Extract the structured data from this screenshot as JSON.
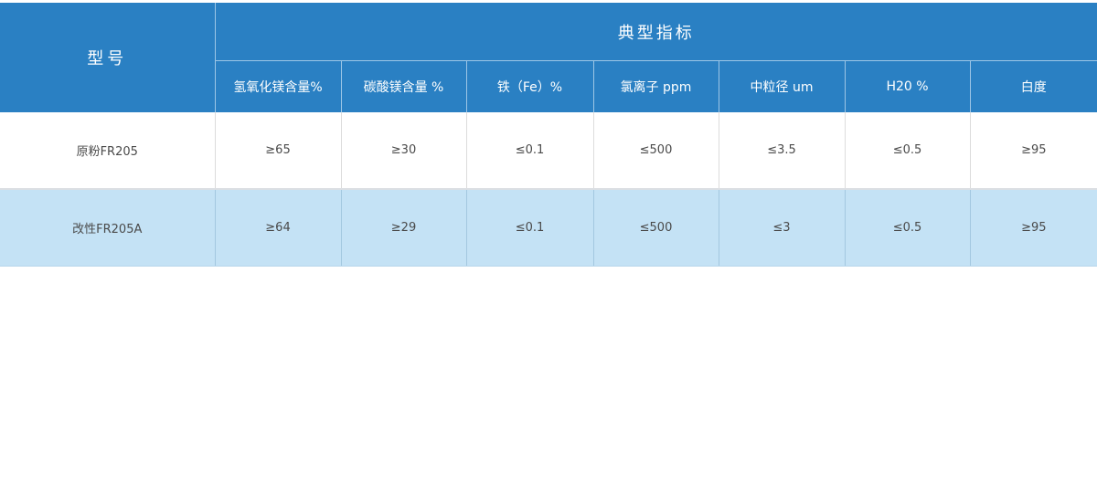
{
  "table": {
    "model_header": "型号",
    "group_header": "典型指标",
    "columns": [
      "氢氧化镁含量%",
      "碳酸镁含量 %",
      "铁（Fe）%",
      "氯离子 ppm",
      "中粒径 um",
      "H20 %",
      "白度"
    ],
    "rows": [
      {
        "model": "原粉FR205",
        "values": [
          "≥65",
          "≥30",
          "≤0.1",
          "≤500",
          "≤3.5",
          "≤0.5",
          "≥95"
        ]
      },
      {
        "model": "改性FR205A",
        "values": [
          "≥64",
          "≥29",
          "≤0.1",
          "≤500",
          "≤3",
          "≤0.5",
          "≥95"
        ]
      }
    ]
  },
  "colors": {
    "header_blue": "#2a80c3",
    "row_highlight": "#c4e2f5"
  }
}
